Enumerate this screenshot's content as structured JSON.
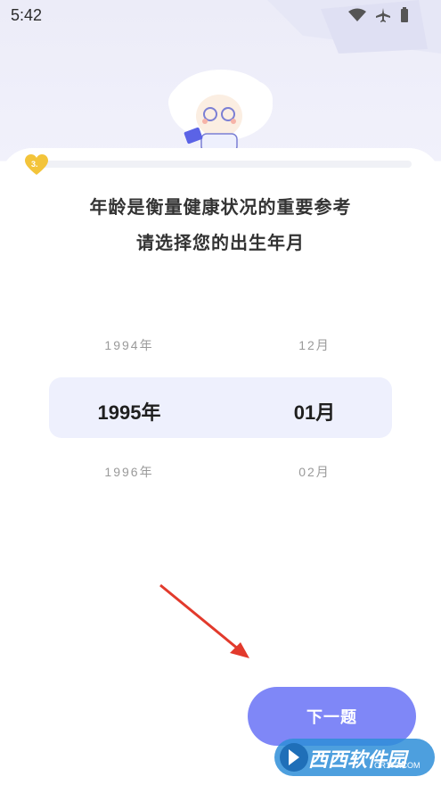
{
  "status_bar": {
    "time": "5:42"
  },
  "progress": {
    "badge": "3.",
    "fraction": 0.02
  },
  "question": {
    "line1": "年龄是衡量健康状况的重要参考",
    "line2": "请选择您的出生年月"
  },
  "picker": {
    "year": {
      "prev": "1994年",
      "selected": "1995年",
      "next": "1996年"
    },
    "month": {
      "prev": "12月",
      "selected": "01月",
      "next": "02月"
    }
  },
  "next_button": {
    "label": "下一题"
  },
  "watermark": {
    "text": "西西软件园",
    "sub": "CR173.COM"
  },
  "colors": {
    "accent": "#7f87f7",
    "badge": "#f3c43a",
    "arrow": "#e23a2c",
    "highlight": "#eef0fd"
  }
}
